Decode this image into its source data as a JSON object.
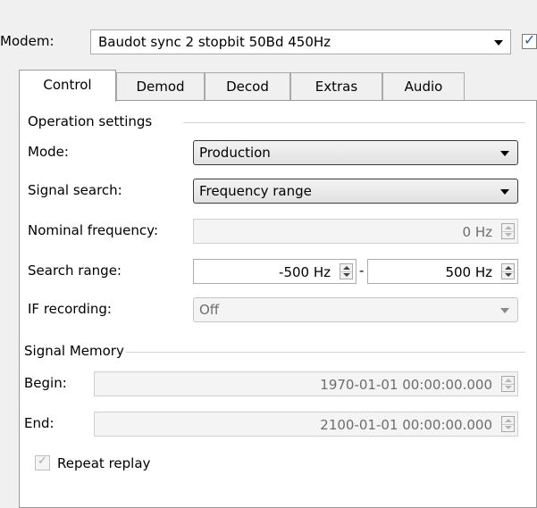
{
  "modem": {
    "label": "Modem:",
    "value": "Baudot sync 2 stopbit 50Bd 450Hz",
    "checked": true
  },
  "tabs": [
    {
      "label": "Control",
      "active": true
    },
    {
      "label": "Demod"
    },
    {
      "label": "Decod"
    },
    {
      "label": "Extras"
    },
    {
      "label": "Audio"
    }
  ],
  "operation": {
    "title": "Operation settings",
    "mode_label": "Mode:",
    "mode_value": "Production",
    "signal_search_label": "Signal search:",
    "signal_search_value": "Frequency range",
    "nominal_label": "Nominal frequency:",
    "nominal_value": "0 Hz",
    "search_range_label": "Search range:",
    "search_range_from": "-500 Hz",
    "search_range_sep": "-",
    "search_range_to": "500 Hz",
    "if_label": "IF recording:",
    "if_value": "Off"
  },
  "memory": {
    "title": "Signal Memory",
    "begin_label": "Begin:",
    "begin_value": "1970-01-01 00:00:00.000",
    "end_label": "End:",
    "end_value": "2100-01-01 00:00:00.000",
    "repeat_label": "Repeat replay",
    "repeat_checked": true
  },
  "icons": {
    "check": "✓"
  }
}
